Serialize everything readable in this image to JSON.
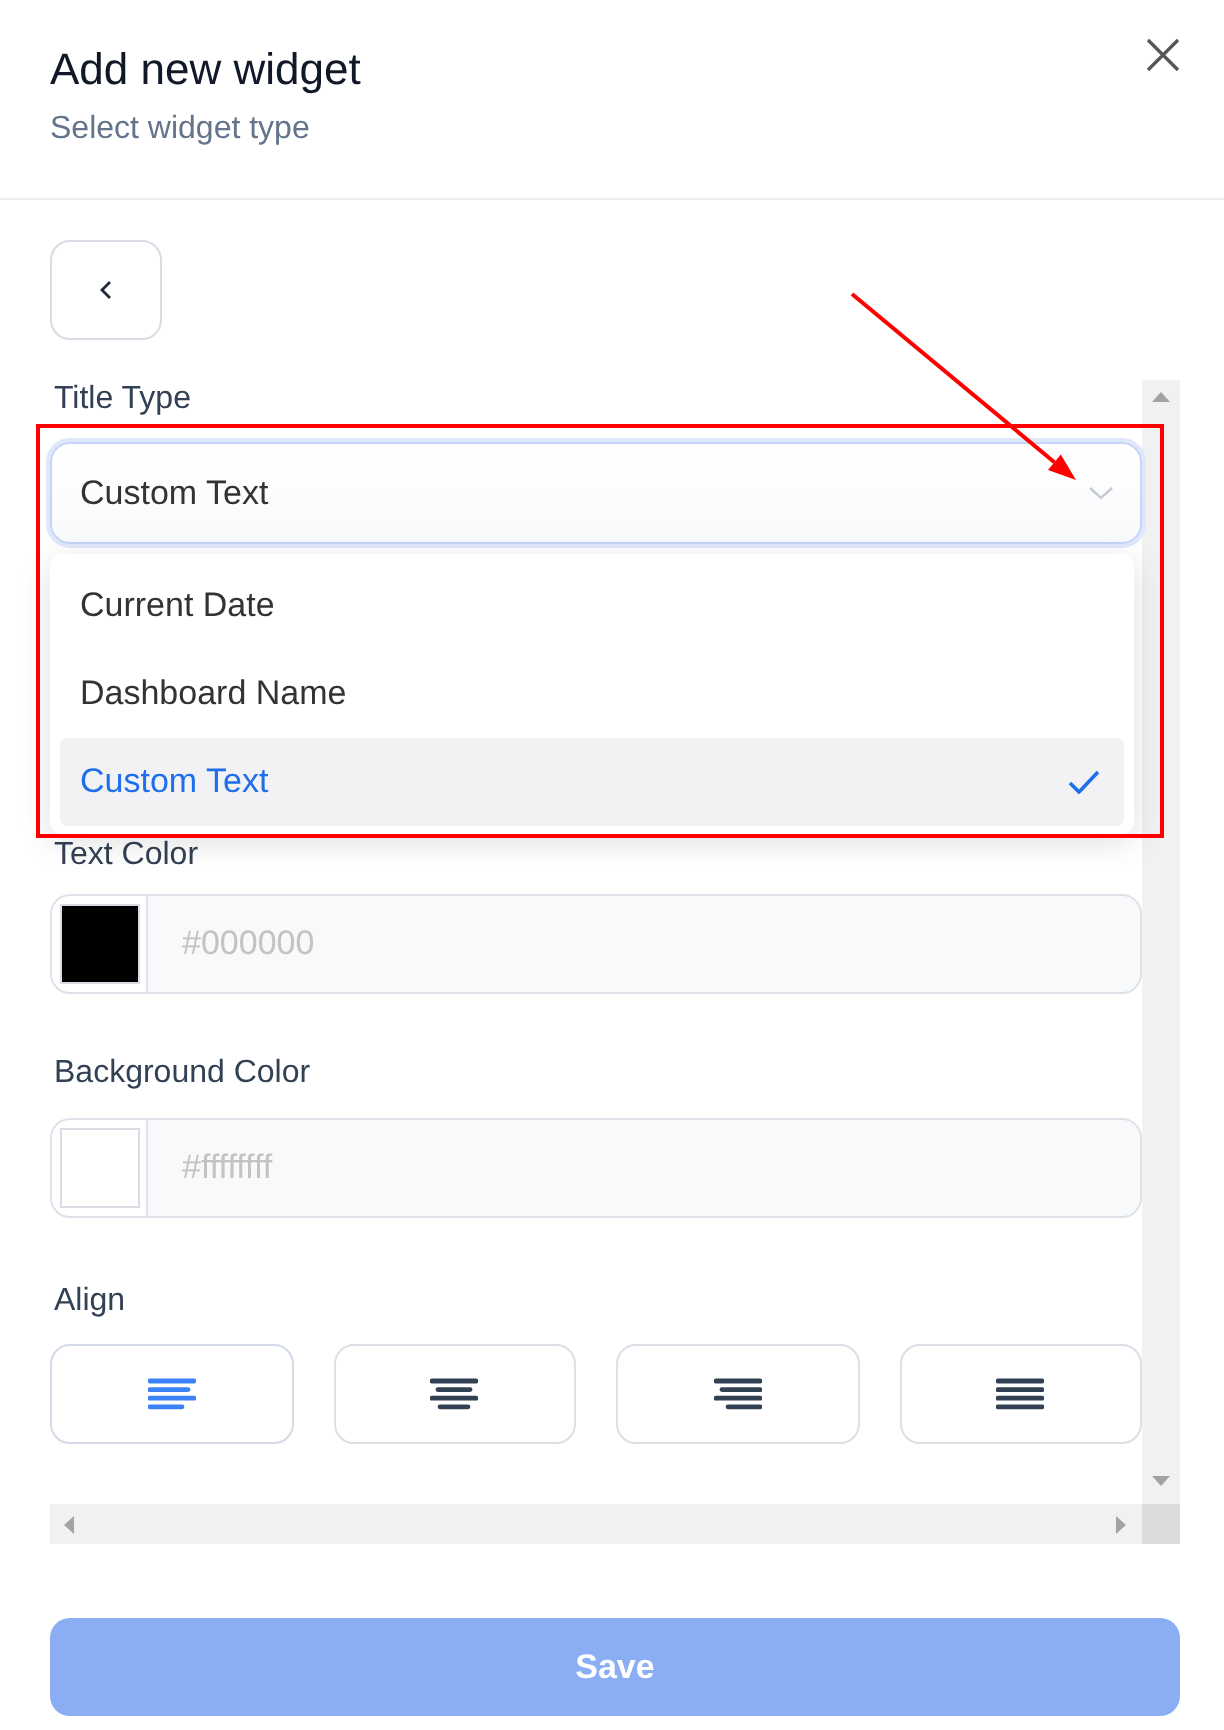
{
  "header": {
    "title": "Add new widget",
    "subtitle": "Select widget type"
  },
  "title_type": {
    "label": "Title Type",
    "value": "Custom Text",
    "expanded": true,
    "options": [
      {
        "label": "Current Date",
        "selected": false
      },
      {
        "label": "Dashboard Name",
        "selected": false
      },
      {
        "label": "Custom Text",
        "selected": true
      }
    ]
  },
  "color_fields": [
    {
      "label": "Text Color",
      "placeholder": "#000000",
      "color": "#000000"
    },
    {
      "label": "Background Color",
      "placeholder": "#ffffffff",
      "color": "#ffffff"
    }
  ],
  "align": {
    "label": "Align",
    "options": [
      {
        "kind": "left",
        "selected": true
      },
      {
        "kind": "center",
        "selected": false
      },
      {
        "kind": "right",
        "selected": false
      },
      {
        "kind": "justify",
        "selected": false
      }
    ]
  },
  "save_button": {
    "label": "Save",
    "disabled": true
  }
}
